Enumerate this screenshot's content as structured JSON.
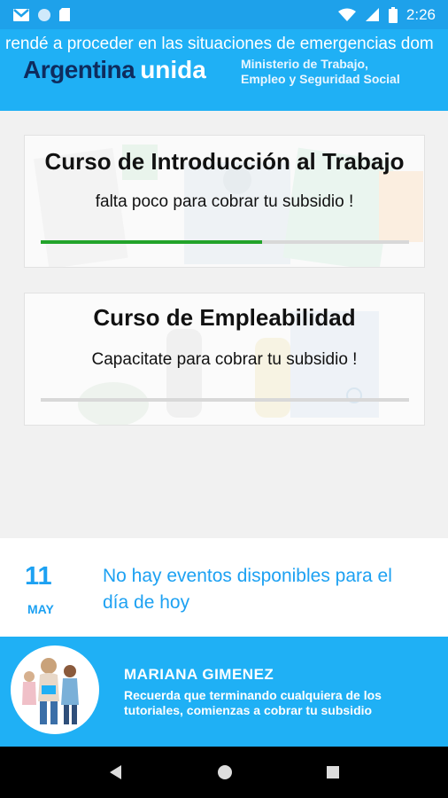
{
  "status_bar": {
    "time": "2:26",
    "icons": [
      "gmail-icon",
      "circle-icon",
      "sd-card-icon",
      "wifi-icon",
      "signal-icon",
      "battery-icon"
    ]
  },
  "header": {
    "marquee": "rendé a proceder en las situaciones de emergencias dom",
    "brand_primary": "Argentina",
    "brand_secondary": "unida",
    "ministry_line1": "Ministerio de Trabajo,",
    "ministry_line2": "Empleo y Seguridad Social"
  },
  "courses": [
    {
      "title": "Curso de Introducción al Trabajo",
      "subtitle": "falta poco para cobrar tu subsidio !",
      "progress": 0.6
    },
    {
      "title": "Curso de Empleabilidad",
      "subtitle": "Capacitate para cobrar tu subsidio !",
      "progress": 0.0
    }
  ],
  "events": {
    "day": "11",
    "month": "MAY",
    "message": "No hay eventos disponibles para el día de hoy"
  },
  "mentor": {
    "name": "MARIANA GIMENEZ",
    "message": "Recuerda que terminando cualquiera de los tutoriales, comienzas a cobrar tu subsidio"
  },
  "colors": {
    "primary": "#1fb0f5",
    "accent_text": "#1da1f2",
    "progress": "#22a32a",
    "brand_dark": "#0e2c5e"
  }
}
